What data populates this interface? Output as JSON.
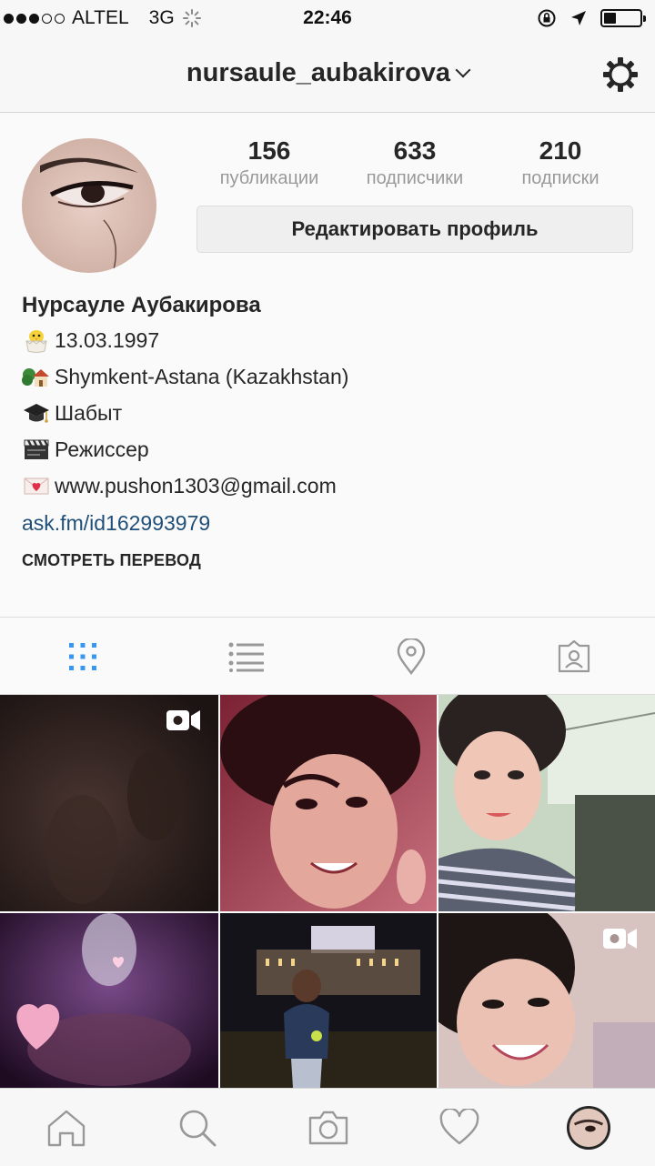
{
  "status_bar": {
    "carrier": "ALTEL",
    "network": "3G",
    "time": "22:46",
    "battery_level": 0.35
  },
  "nav": {
    "username": "nursaule_aubakirova",
    "settings_icon": "gear-icon",
    "dropdown_icon": "chevron-down-icon"
  },
  "stats": {
    "posts": {
      "count": "156",
      "label": "публикации"
    },
    "followers": {
      "count": "633",
      "label": "подписчики"
    },
    "following": {
      "count": "210",
      "label": "подписки"
    }
  },
  "edit_profile_label": "Редактировать профиль",
  "bio": {
    "name": "Нурсауле Аубакирова",
    "lines": [
      {
        "icon": "hatching-chick-icon",
        "text": "13.03.1997"
      },
      {
        "icon": "house-with-garden-icon",
        "text": "Shymkent-Astana (Kazakhstan)"
      },
      {
        "icon": "graduation-cap-icon",
        "text": "Шабыт"
      },
      {
        "icon": "clapper-board-icon",
        "text": "Режиссер"
      },
      {
        "icon": "love-letter-icon",
        "text": " www.pushon1303@gmail.com"
      }
    ],
    "link": "ask.fm/id162993979",
    "translate_label": "СМОТРЕТЬ ПЕРЕВОД"
  },
  "tabs": [
    {
      "name": "grid-view-icon",
      "active": true
    },
    {
      "name": "list-view-icon",
      "active": false
    },
    {
      "name": "location-pin-icon",
      "active": false
    },
    {
      "name": "tagged-photos-icon",
      "active": false
    }
  ],
  "posts": [
    {
      "kind": "video"
    },
    {
      "kind": "photo"
    },
    {
      "kind": "photo"
    },
    {
      "kind": "photo"
    },
    {
      "kind": "photo"
    },
    {
      "kind": "video"
    }
  ],
  "bottom_nav": [
    {
      "name": "home-icon"
    },
    {
      "name": "search-icon"
    },
    {
      "name": "camera-icon"
    },
    {
      "name": "heart-icon"
    },
    {
      "name": "profile-avatar"
    }
  ],
  "colors": {
    "link": "#1f4f78",
    "active_tab": "#3897f0",
    "inactive_icon": "#999999"
  }
}
